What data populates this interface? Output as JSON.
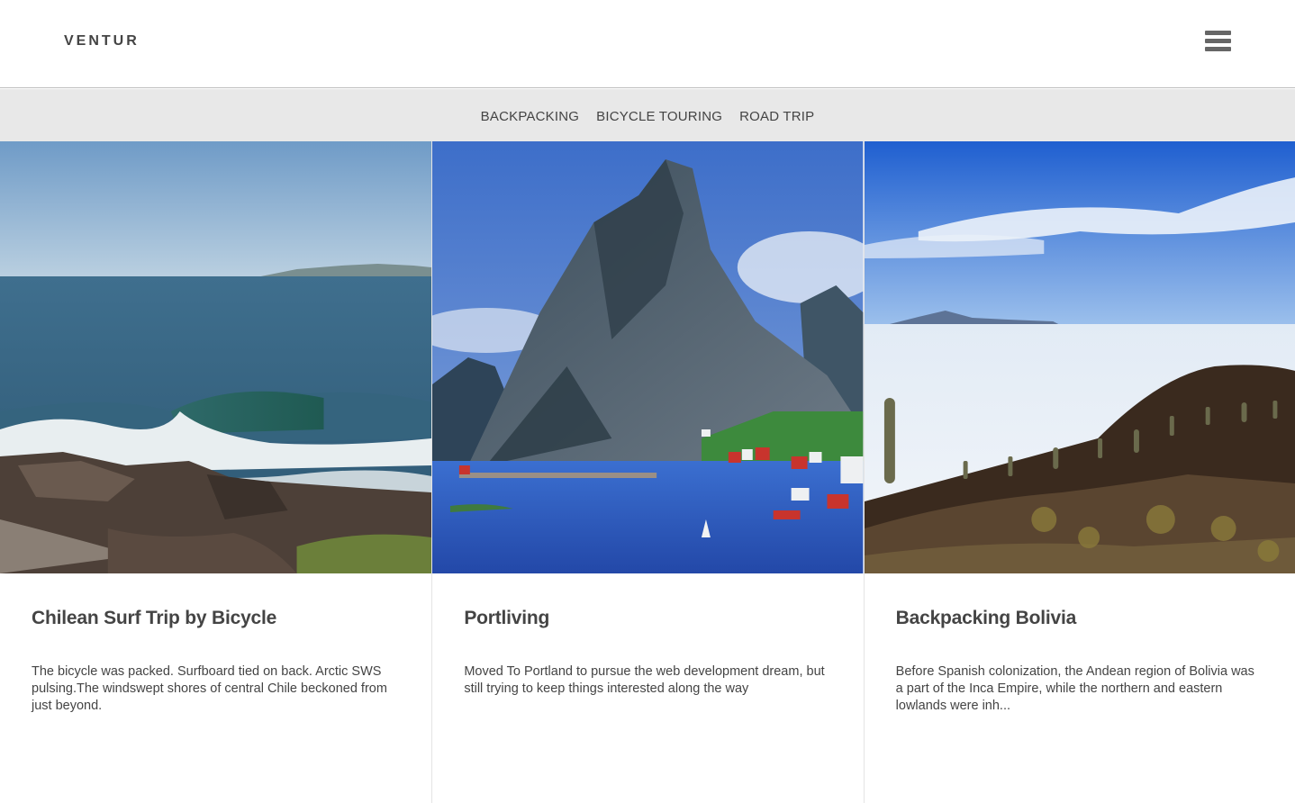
{
  "header": {
    "brand": "VENTUR",
    "menu_icon": "hamburger-menu-icon"
  },
  "categories": [
    {
      "label": "BACKPACKING"
    },
    {
      "label": "BICYCLE TOURING"
    },
    {
      "label": "ROAD TRIP"
    }
  ],
  "posts": [
    {
      "title": "Chilean Surf Trip by Bicycle",
      "excerpt": "The bicycle was packed. Surfboard tied on back. Arctic SWS pulsing.The windswept shores of central Chile beckoned from just beyond.",
      "image": "ocean-wave-rocky-coast"
    },
    {
      "title": "Portliving",
      "excerpt": "Moved To Portland to pursue the web development dream, but still trying to keep things interested along the way",
      "image": "mountain-peak-fjord-village"
    },
    {
      "title": "Backpacking Bolivia",
      "excerpt": "Before Spanish colonization, the Andean region of Bolivia was a part of the Inca Empire, while the northern and eastern lowlands were inh...",
      "image": "salt-flat-cactus-hill"
    }
  ],
  "colors": {
    "text": "#444444",
    "category_bar": "#e8e8e8",
    "menu_icon": "#666666"
  }
}
